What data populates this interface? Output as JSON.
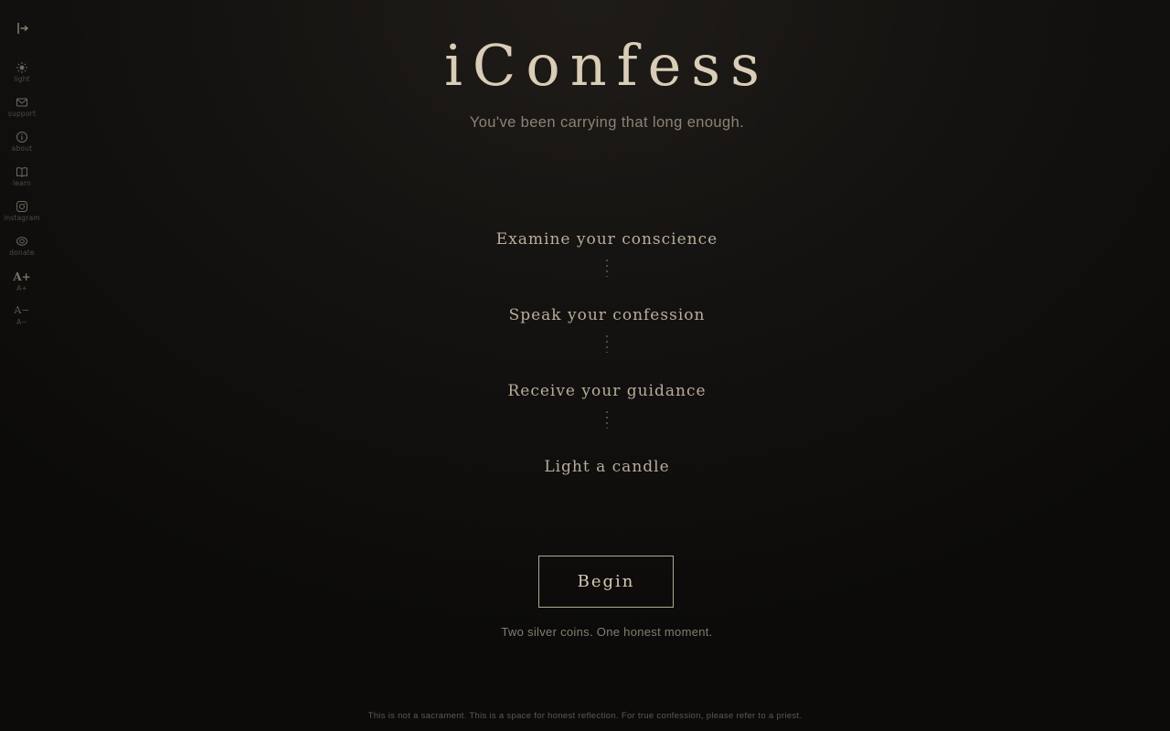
{
  "sidebar": {
    "collapse_icon": "collapse-sidebar-icon",
    "items": [
      {
        "icon": "sun-icon",
        "label": "light"
      },
      {
        "icon": "envelope-icon",
        "label": "support"
      },
      {
        "icon": "info-icon",
        "label": "about"
      },
      {
        "icon": "book-icon",
        "label": "learn"
      },
      {
        "icon": "instagram-icon",
        "label": "instagram"
      },
      {
        "icon": "coin-icon",
        "label": "donate"
      },
      {
        "icon_text": "A+",
        "label": "A+"
      },
      {
        "icon_text": "A−",
        "label": "A−"
      }
    ]
  },
  "header": {
    "title": "iConfess",
    "subtitle": "You've been carrying that long enough."
  },
  "steps": [
    "Examine your conscience",
    "Speak your confession",
    "Receive your guidance",
    "Light a candle"
  ],
  "cta": {
    "begin_label": "Begin",
    "note": "Two silver coins. One honest moment."
  },
  "footer": {
    "disclaimer": "This is not a sacrament. This is a space for honest reflection. For true confession, please refer to a priest."
  },
  "colors": {
    "background": "#151311",
    "title": "#d9cdb6",
    "accent_border": "#b3a98f",
    "muted_text": "#8c8375"
  }
}
